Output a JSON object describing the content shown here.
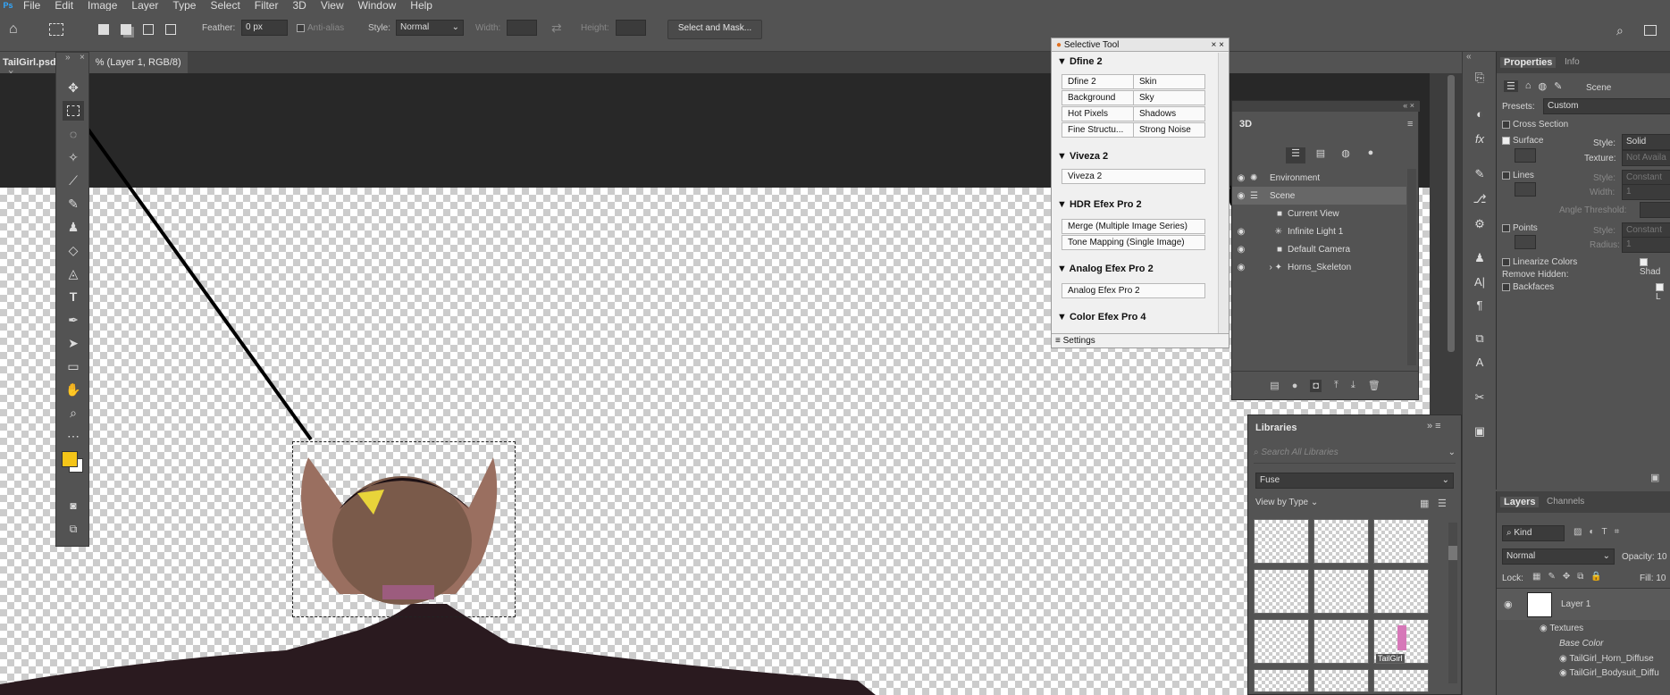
{
  "menu": {
    "app_icon": "Ps",
    "items": [
      "File",
      "Edit",
      "Image",
      "Layer",
      "Type",
      "Select",
      "Filter",
      "3D",
      "View",
      "Window",
      "Help"
    ]
  },
  "options": {
    "feather_label": "Feather:",
    "feather_value": "0 px",
    "antialias_label": "Anti-alias",
    "style_label": "Style:",
    "style_value": "Normal",
    "width_label": "Width:",
    "height_label": "Height:",
    "select_mask_label": "Select and Mask..."
  },
  "document": {
    "tab_title": "TailGirl.psd",
    "tab_suffix": "% (Layer 1, RGB/8)"
  },
  "colors": {
    "foreground": "#f5c518",
    "background": "#ffffff",
    "accent": "#31a8ff",
    "annotation": "#000000"
  },
  "selective_tool": {
    "title": "Selective Tool",
    "dfine_header": "Dfine 2",
    "dfine_buttons": [
      "Dfine 2",
      "Skin",
      "Background",
      "Sky",
      "Hot Pixels",
      "Shadows",
      "Fine Structu...",
      "Strong Noise"
    ],
    "viveza_header": "Viveza 2",
    "viveza_button": "Viveza 2",
    "hdr_header": "HDR Efex Pro 2",
    "hdr_buttons": [
      "Merge (Multiple Image Series)",
      "Tone Mapping (Single Image)"
    ],
    "analog_header": "Analog Efex Pro 2",
    "analog_button": "Analog Efex Pro 2",
    "color_header": "Color Efex Pro 4",
    "settings": "Settings"
  },
  "panel3d": {
    "tab": "3D",
    "rows": [
      "Environment",
      "Scene",
      "Current View",
      "Infinite Light 1",
      "Default Camera",
      "Horns_Skeleton"
    ]
  },
  "libraries": {
    "tab": "Libraries",
    "search_placeholder": "Search All Libraries",
    "library": "Fuse",
    "view_by": "View by Type",
    "thumb_label": "TailGirl"
  },
  "properties": {
    "tabs": [
      "Properties",
      "Info"
    ],
    "scene_label": "Scene",
    "presets_label": "Presets:",
    "presets_value": "Custom",
    "cross_section": "Cross Section",
    "surface": "Surface",
    "surface_style_label": "Style:",
    "surface_style": "Solid",
    "texture_label": "Texture:",
    "texture_value": "Not Availa",
    "lines": "Lines",
    "lines_style_label": "Style:",
    "lines_style": "Constant",
    "width_label": "Width:",
    "width_value": "1",
    "angle_label": "Angle Threshold:",
    "points": "Points",
    "points_style_label": "Style:",
    "points_style": "Constant",
    "radius_label": "Radius:",
    "radius_value": "1",
    "linearize": "Linearize Colors",
    "shadows": "Shad",
    "remove_hidden": "Remove Hidden:",
    "backfaces": "Backfaces",
    "lines_cb": "L"
  },
  "layers": {
    "tabs": [
      "Layers",
      "Channels"
    ],
    "kind": "Kind",
    "blend": "Normal",
    "opacity_label": "Opacity:",
    "opacity_value": "10",
    "lock_label": "Lock:",
    "fill_label": "Fill:",
    "fill_value": "10",
    "layer_name": "Layer 1",
    "textures": "Textures",
    "base_color": "Base Color",
    "tex1": "TailGirl_Horn_Diffuse",
    "tex2": "TailGirl_Bodysuit_Diffu"
  }
}
